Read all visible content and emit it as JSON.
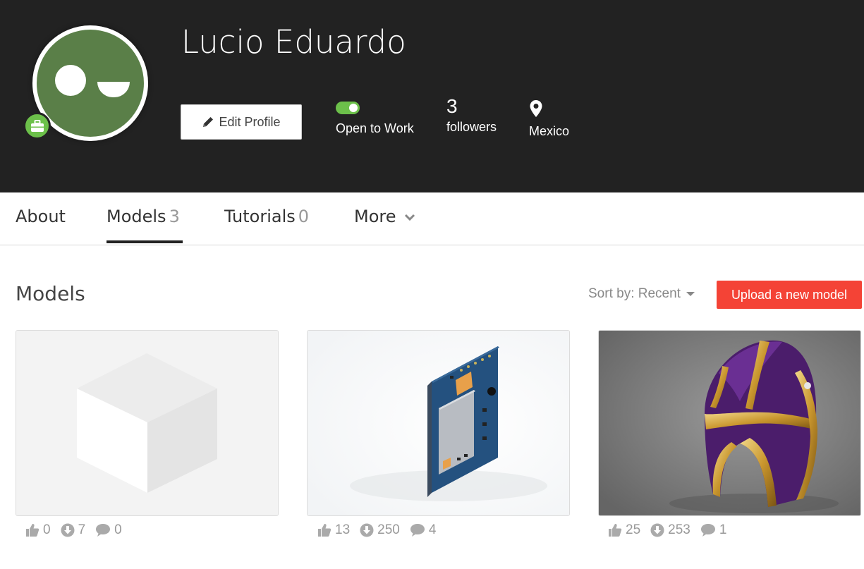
{
  "profile": {
    "name": "Lucio Eduardo",
    "edit_label": "Edit Profile",
    "open_to_work_label": "Open to Work",
    "followers_count": "3",
    "followers_label": "followers",
    "location": "Mexico"
  },
  "tabs": [
    {
      "label": "About",
      "count": ""
    },
    {
      "label": "Models",
      "count": "3"
    },
    {
      "label": "Tutorials",
      "count": "0"
    },
    {
      "label": "More",
      "count": ""
    }
  ],
  "models_section": {
    "title": "Models",
    "sort_label": "Sort by: Recent",
    "upload_label": "Upload a new model"
  },
  "cards": [
    {
      "likes": "0",
      "downloads": "7",
      "comments": "0"
    },
    {
      "likes": "13",
      "downloads": "250",
      "comments": "4"
    },
    {
      "likes": "25",
      "downloads": "253",
      "comments": "1"
    }
  ],
  "colors": {
    "header_bg": "#222222",
    "accent_green": "#6cc04a",
    "upload_red": "#f44336",
    "avatar_green": "#5a7f48"
  }
}
